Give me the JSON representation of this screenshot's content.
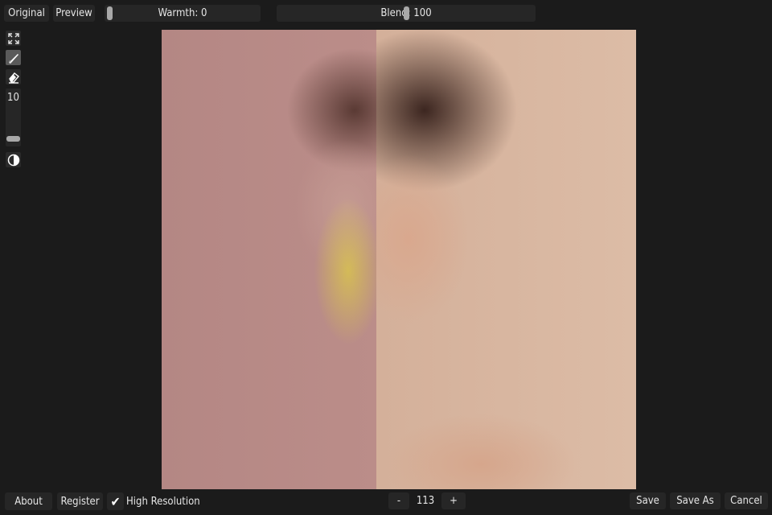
{
  "toolbar": {
    "original_label": "Original",
    "preview_label": "Preview",
    "warmth_label": "Warmth: 0",
    "warmth_value": 0,
    "blend_label": "Blend: 100",
    "blend_value": 100
  },
  "tools": {
    "fit_icon": "fullscreen-icon",
    "brush_icon": "brush-icon",
    "eraser_icon": "eraser-icon",
    "brush_size": "10",
    "contrast_icon": "contrast-icon"
  },
  "bottom": {
    "about_label": "About",
    "register_label": "Register",
    "high_res_label": "High Resolution",
    "high_res_checked": true,
    "zoom_minus": "-",
    "zoom_value": "113",
    "zoom_plus": "+",
    "save_label": "Save",
    "save_as_label": "Save As",
    "cancel_label": "Cancel"
  },
  "colors": {
    "background": "#1b1b1b",
    "button": "#262626",
    "highlight_overlay": "#e8e030"
  }
}
